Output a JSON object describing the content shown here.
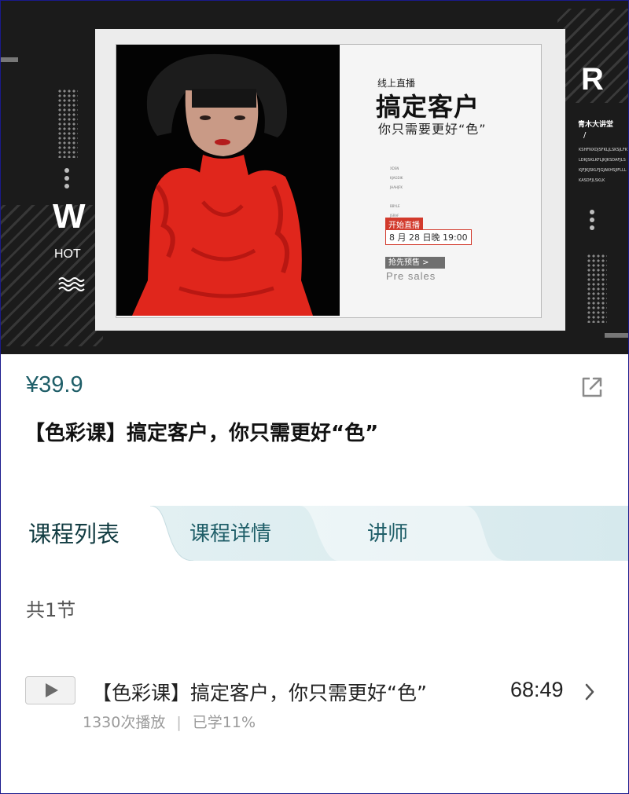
{
  "banner": {
    "left_letter": "W",
    "left_tag": "HOT",
    "right_letter": "R",
    "brand_name": "青木大讲堂",
    "brand_slash": "/",
    "brand_small": "KSHFNXDJSFKLJLSKSJLFKLDKJSKLKFLJKJKSDAFJLSKJFJKJSKLFJGJAKHSJIFLLLKASDFJLSKLK",
    "live_label": "线上直播",
    "headline": "搞定客户",
    "subline": "你只需要更好“色”",
    "tiny_lines": [
      "XDSN",
      "KJAGDIK",
      "JHAHJFK",
      "",
      "BBYLE",
      "JSRAF"
    ],
    "start_tag": "开始直播",
    "date_text": "8 月 28 日晚 19:00",
    "presale_button": "抢先预售  >",
    "presale_en": "Pre sales"
  },
  "product": {
    "price": "¥39.9",
    "title": "【色彩课】搞定客户，你只需更好“色”"
  },
  "tabs": [
    {
      "label": "课程列表",
      "active": true
    },
    {
      "label": "课程详情",
      "active": false
    },
    {
      "label": "讲师",
      "active": false
    }
  ],
  "lesson_count": "共1节",
  "lessons": [
    {
      "title": "【色彩课】搞定客户，你只需更好“色”",
      "duration": "68:49",
      "plays": "1330次播放",
      "separator": "|",
      "progress": "已学11%"
    }
  ],
  "icons": {
    "share": "share-icon",
    "play": "play-icon",
    "chevron": "chevron-right-icon"
  },
  "colors": {
    "accent": "#1f5e68",
    "live_red": "#d23a2c",
    "dress_red": "#e0261c"
  }
}
